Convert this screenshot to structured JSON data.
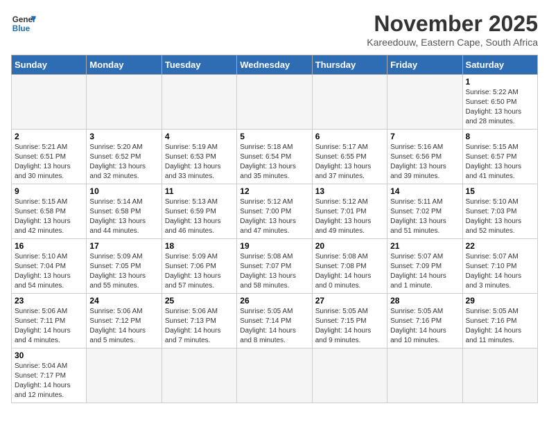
{
  "logo": {
    "line1": "General",
    "line2": "Blue"
  },
  "header": {
    "month_year": "November 2025",
    "location": "Kareedouw, Eastern Cape, South Africa"
  },
  "weekdays": [
    "Sunday",
    "Monday",
    "Tuesday",
    "Wednesday",
    "Thursday",
    "Friday",
    "Saturday"
  ],
  "days": [
    {
      "num": "",
      "sunrise": "",
      "sunset": "",
      "daylight": ""
    },
    {
      "num": "",
      "sunrise": "",
      "sunset": "",
      "daylight": ""
    },
    {
      "num": "",
      "sunrise": "",
      "sunset": "",
      "daylight": ""
    },
    {
      "num": "",
      "sunrise": "",
      "sunset": "",
      "daylight": ""
    },
    {
      "num": "",
      "sunrise": "",
      "sunset": "",
      "daylight": ""
    },
    {
      "num": "",
      "sunrise": "",
      "sunset": "",
      "daylight": ""
    },
    {
      "num": "1",
      "sunrise": "Sunrise: 5:22 AM",
      "sunset": "Sunset: 6:50 PM",
      "daylight": "Daylight: 13 hours and 28 minutes."
    },
    {
      "num": "2",
      "sunrise": "Sunrise: 5:21 AM",
      "sunset": "Sunset: 6:51 PM",
      "daylight": "Daylight: 13 hours and 30 minutes."
    },
    {
      "num": "3",
      "sunrise": "Sunrise: 5:20 AM",
      "sunset": "Sunset: 6:52 PM",
      "daylight": "Daylight: 13 hours and 32 minutes."
    },
    {
      "num": "4",
      "sunrise": "Sunrise: 5:19 AM",
      "sunset": "Sunset: 6:53 PM",
      "daylight": "Daylight: 13 hours and 33 minutes."
    },
    {
      "num": "5",
      "sunrise": "Sunrise: 5:18 AM",
      "sunset": "Sunset: 6:54 PM",
      "daylight": "Daylight: 13 hours and 35 minutes."
    },
    {
      "num": "6",
      "sunrise": "Sunrise: 5:17 AM",
      "sunset": "Sunset: 6:55 PM",
      "daylight": "Daylight: 13 hours and 37 minutes."
    },
    {
      "num": "7",
      "sunrise": "Sunrise: 5:16 AM",
      "sunset": "Sunset: 6:56 PM",
      "daylight": "Daylight: 13 hours and 39 minutes."
    },
    {
      "num": "8",
      "sunrise": "Sunrise: 5:15 AM",
      "sunset": "Sunset: 6:57 PM",
      "daylight": "Daylight: 13 hours and 41 minutes."
    },
    {
      "num": "9",
      "sunrise": "Sunrise: 5:15 AM",
      "sunset": "Sunset: 6:58 PM",
      "daylight": "Daylight: 13 hours and 42 minutes."
    },
    {
      "num": "10",
      "sunrise": "Sunrise: 5:14 AM",
      "sunset": "Sunset: 6:58 PM",
      "daylight": "Daylight: 13 hours and 44 minutes."
    },
    {
      "num": "11",
      "sunrise": "Sunrise: 5:13 AM",
      "sunset": "Sunset: 6:59 PM",
      "daylight": "Daylight: 13 hours and 46 minutes."
    },
    {
      "num": "12",
      "sunrise": "Sunrise: 5:12 AM",
      "sunset": "Sunset: 7:00 PM",
      "daylight": "Daylight: 13 hours and 47 minutes."
    },
    {
      "num": "13",
      "sunrise": "Sunrise: 5:12 AM",
      "sunset": "Sunset: 7:01 PM",
      "daylight": "Daylight: 13 hours and 49 minutes."
    },
    {
      "num": "14",
      "sunrise": "Sunrise: 5:11 AM",
      "sunset": "Sunset: 7:02 PM",
      "daylight": "Daylight: 13 hours and 51 minutes."
    },
    {
      "num": "15",
      "sunrise": "Sunrise: 5:10 AM",
      "sunset": "Sunset: 7:03 PM",
      "daylight": "Daylight: 13 hours and 52 minutes."
    },
    {
      "num": "16",
      "sunrise": "Sunrise: 5:10 AM",
      "sunset": "Sunset: 7:04 PM",
      "daylight": "Daylight: 13 hours and 54 minutes."
    },
    {
      "num": "17",
      "sunrise": "Sunrise: 5:09 AM",
      "sunset": "Sunset: 7:05 PM",
      "daylight": "Daylight: 13 hours and 55 minutes."
    },
    {
      "num": "18",
      "sunrise": "Sunrise: 5:09 AM",
      "sunset": "Sunset: 7:06 PM",
      "daylight": "Daylight: 13 hours and 57 minutes."
    },
    {
      "num": "19",
      "sunrise": "Sunrise: 5:08 AM",
      "sunset": "Sunset: 7:07 PM",
      "daylight": "Daylight: 13 hours and 58 minutes."
    },
    {
      "num": "20",
      "sunrise": "Sunrise: 5:08 AM",
      "sunset": "Sunset: 7:08 PM",
      "daylight": "Daylight: 14 hours and 0 minutes."
    },
    {
      "num": "21",
      "sunrise": "Sunrise: 5:07 AM",
      "sunset": "Sunset: 7:09 PM",
      "daylight": "Daylight: 14 hours and 1 minute."
    },
    {
      "num": "22",
      "sunrise": "Sunrise: 5:07 AM",
      "sunset": "Sunset: 7:10 PM",
      "daylight": "Daylight: 14 hours and 3 minutes."
    },
    {
      "num": "23",
      "sunrise": "Sunrise: 5:06 AM",
      "sunset": "Sunset: 7:11 PM",
      "daylight": "Daylight: 14 hours and 4 minutes."
    },
    {
      "num": "24",
      "sunrise": "Sunrise: 5:06 AM",
      "sunset": "Sunset: 7:12 PM",
      "daylight": "Daylight: 14 hours and 5 minutes."
    },
    {
      "num": "25",
      "sunrise": "Sunrise: 5:06 AM",
      "sunset": "Sunset: 7:13 PM",
      "daylight": "Daylight: 14 hours and 7 minutes."
    },
    {
      "num": "26",
      "sunrise": "Sunrise: 5:05 AM",
      "sunset": "Sunset: 7:14 PM",
      "daylight": "Daylight: 14 hours and 8 minutes."
    },
    {
      "num": "27",
      "sunrise": "Sunrise: 5:05 AM",
      "sunset": "Sunset: 7:15 PM",
      "daylight": "Daylight: 14 hours and 9 minutes."
    },
    {
      "num": "28",
      "sunrise": "Sunrise: 5:05 AM",
      "sunset": "Sunset: 7:16 PM",
      "daylight": "Daylight: 14 hours and 10 minutes."
    },
    {
      "num": "29",
      "sunrise": "Sunrise: 5:05 AM",
      "sunset": "Sunset: 7:16 PM",
      "daylight": "Daylight: 14 hours and 11 minutes."
    },
    {
      "num": "30",
      "sunrise": "Sunrise: 5:04 AM",
      "sunset": "Sunset: 7:17 PM",
      "daylight": "Daylight: 14 hours and 12 minutes."
    }
  ]
}
